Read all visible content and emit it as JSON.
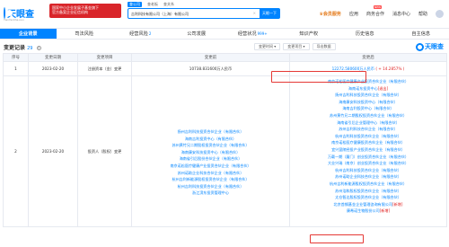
{
  "header": {
    "logo_text": "天眼查",
    "logo_url": "TianYanCha.com",
    "promo_line1": "国家中小企业发展子基金旗下",
    "promo_line2": "官方备案企业征信机构",
    "search_tabs": [
      "查公司",
      "查老板",
      "查关系"
    ],
    "search_value": "吉利科技有限公司（上海）有限公司",
    "search_button": "天眼一下",
    "nav": [
      {
        "label": "会员服务",
        "badge": ""
      },
      {
        "label": "应用",
        "badge": ""
      },
      {
        "label": "商务合作",
        "badge": "NEW"
      },
      {
        "label": "消息中心",
        "badge": ""
      },
      {
        "label": "帮助",
        "badge": ""
      }
    ]
  },
  "tabs": [
    {
      "label": "企业背景",
      "count": "",
      "active": true
    },
    {
      "label": "司法风险",
      "count": "",
      "active": false
    },
    {
      "label": "经营风险",
      "count": "2",
      "active": false
    },
    {
      "label": "公司发展",
      "count": "",
      "active": false
    },
    {
      "label": "经营状况",
      "count": "999+",
      "active": false
    },
    {
      "label": "知识产权",
      "count": "",
      "active": false
    },
    {
      "label": "历史信息",
      "count": "",
      "active": false
    },
    {
      "label": "自主信息",
      "count": "",
      "active": false
    }
  ],
  "section": {
    "title": "变更记录",
    "count": "29",
    "filters": [
      "变更时间",
      "变更项目",
      "导出数据"
    ],
    "brand": "天眼查"
  },
  "table": {
    "headers": [
      "序号",
      "变更日期",
      "变更项目",
      "变更前",
      "变更后"
    ],
    "rows": [
      {
        "index": "1",
        "date": "2023-02-20",
        "item": "注册资本（金）变更",
        "before": [
          "10738.831600万人民币"
        ],
        "after_value": "12272.580600万人民币",
        "after_diff": "( + 14.2857% )"
      },
      {
        "index": "2",
        "date": "2023-02-20",
        "item": "投资人（股权）变更",
        "before": [
          "扬州吉利科技投资合伙企业（有限合伙）",
          "海南吉利投资中心（有限合伙）",
          "苏州黄竹兄二期股权投资合伙企业（有限合伙）",
          "海南康安科技投资中心（有限合伙）",
          "",
          "海南省引后股份合伙企业（有限合伙）",
          "南京诺松医疗健康产业投资合伙企业（有限合伙）",
          "苏州诺助企业科技合伙企业（有限合伙）",
          "杭州吉利新能源股权投资合伙企业（有限合伙）",
          "杭州吉利科技投资合伙企业（有限合伙）",
          "浙江滨东投资管理中心"
        ],
        "after": [
          {
            "text": "南京诺松医疗健康产业投资合伙企业（有限合伙）",
            "tag": ""
          },
          {
            "text": "海南诺东投资中心",
            "tag": "[退出]"
          },
          {
            "text": "扬州吉利科技投资合伙企业（有限合伙）",
            "tag": ""
          },
          {
            "text": "海南康安科技投资中心（有限合伙）",
            "tag": ""
          },
          {
            "text": "海南吉利投资中心（有限合伙）",
            "tag": ""
          },
          {
            "text": "苏州黄竹兄二期股权投资合伙企业（有限合伙）",
            "tag": ""
          },
          {
            "text": "海南省引后企业管理中心（有限合伙）",
            "tag": ""
          },
          {
            "text": "苏州吉利科技合伙企业（有限合伙）",
            "tag": ""
          },
          {
            "text": "杭州吉利科技投资合伙企业（有限合伙）",
            "tag": ""
          },
          {
            "text": "南京诺松医疗健康投资合伙企业（有限合伙）",
            "tag": ""
          },
          {
            "text": "宜兴昆陵经投产业投资合伙企业（有限合伙）",
            "tag": ""
          },
          {
            "text": "万载一期（厦门）创业投资合伙企业（有限合伙）",
            "tag": ""
          },
          {
            "text": "大业兴瑞（南京）创业投资合伙企业（有限合伙）",
            "tag": ""
          },
          {
            "text": "杭州吉利科技投资合伙企业（有限合伙）",
            "tag": ""
          },
          {
            "text": "苏州诺助企业科技合伙企业（有限合伙）",
            "tag": ""
          },
          {
            "text": "杭州吉利新能源股权投资合伙企业（有限合伙）",
            "tag": ""
          },
          {
            "text": "苏州浩和股权投资合伙企业（有限合伙）",
            "tag": ""
          },
          {
            "text": "太仓智达股权投资合伙企业（有限合伙）",
            "tag": ""
          },
          {
            "text": "北京首钢基金企业管理咨询有限公司",
            "tag": "[新增]"
          },
          {
            "text": "康希诺生物股份公司",
            "tag": "[新增]"
          }
        ]
      }
    ]
  },
  "colors": {
    "brand_blue": "#0084ff",
    "highlight_red": "#e53935",
    "diff_red": "#e02020"
  }
}
